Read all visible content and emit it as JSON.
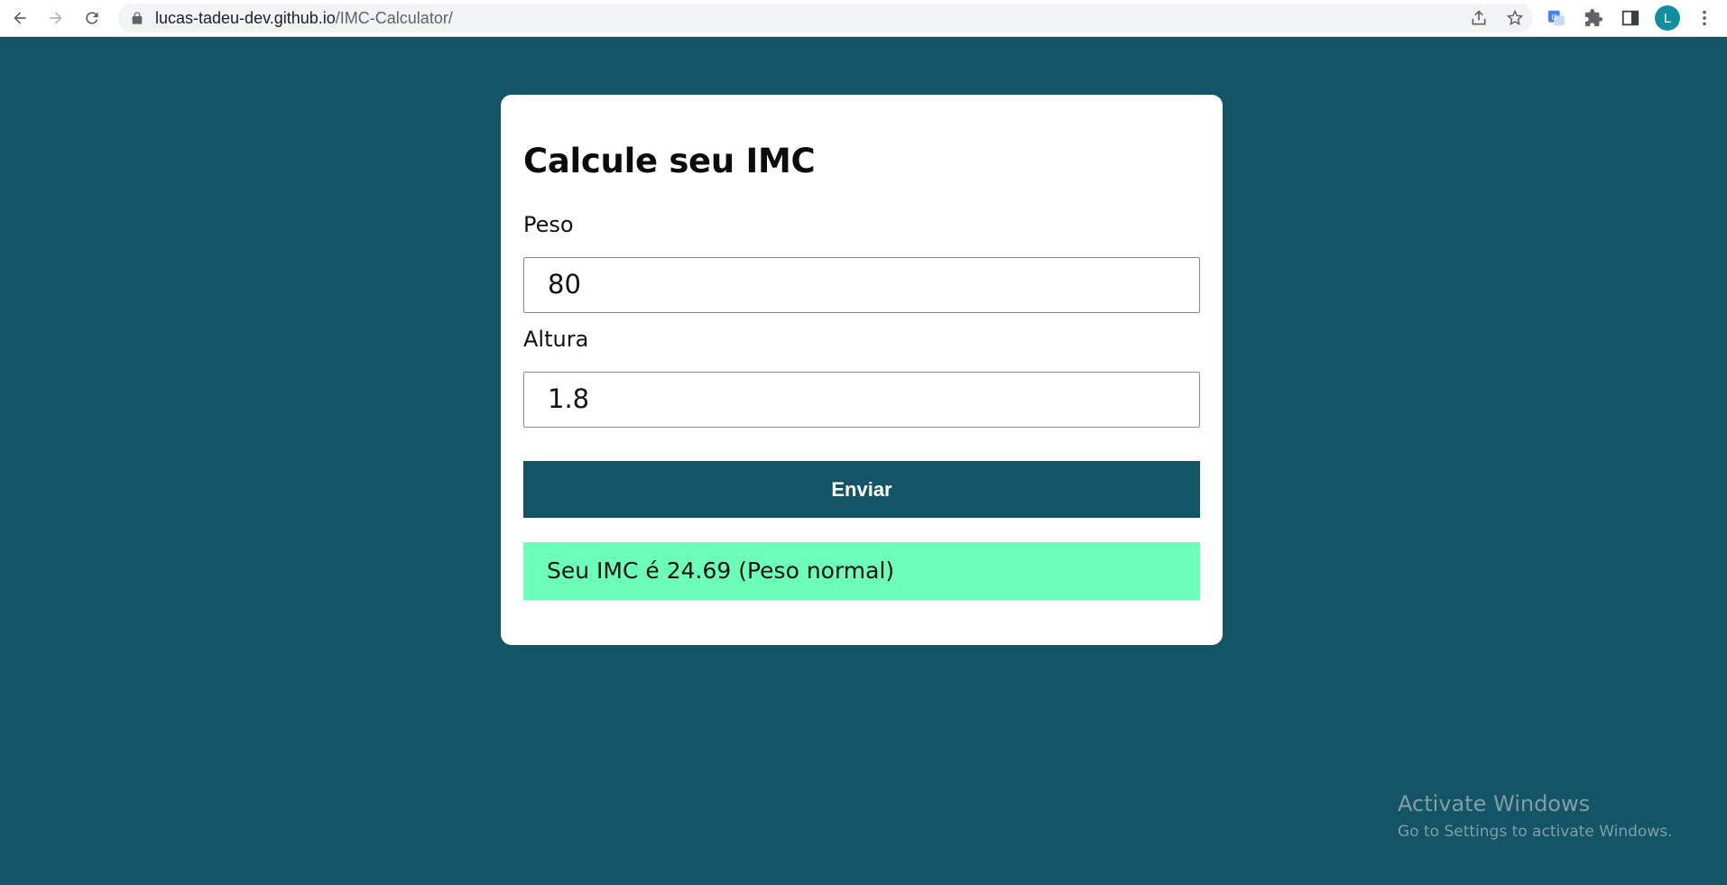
{
  "browser": {
    "url_host": "lucas-tadeu-dev.github.io",
    "url_path": "/IMC-Calculator/",
    "profile_initial": "L",
    "icons": [
      "back-icon",
      "forward-icon",
      "reload-icon",
      "lock-icon",
      "share-icon",
      "bookmark-star-icon",
      "translate-icon",
      "extensions-icon",
      "side-panel-icon",
      "menu-icon"
    ]
  },
  "form": {
    "title": "Calcule seu IMC",
    "weight_label": "Peso",
    "weight_value": "80",
    "height_label": "Altura",
    "height_value": "1.8",
    "submit_label": "Enviar",
    "result_text": "Seu IMC é 24.69 (Peso normal)"
  },
  "watermark": {
    "title": "Activate Windows",
    "subtitle": "Go to Settings to activate Windows."
  },
  "colors": {
    "background": "#135566",
    "button": "#135566",
    "result_bg": "#6cffb8",
    "card": "#ffffff"
  }
}
